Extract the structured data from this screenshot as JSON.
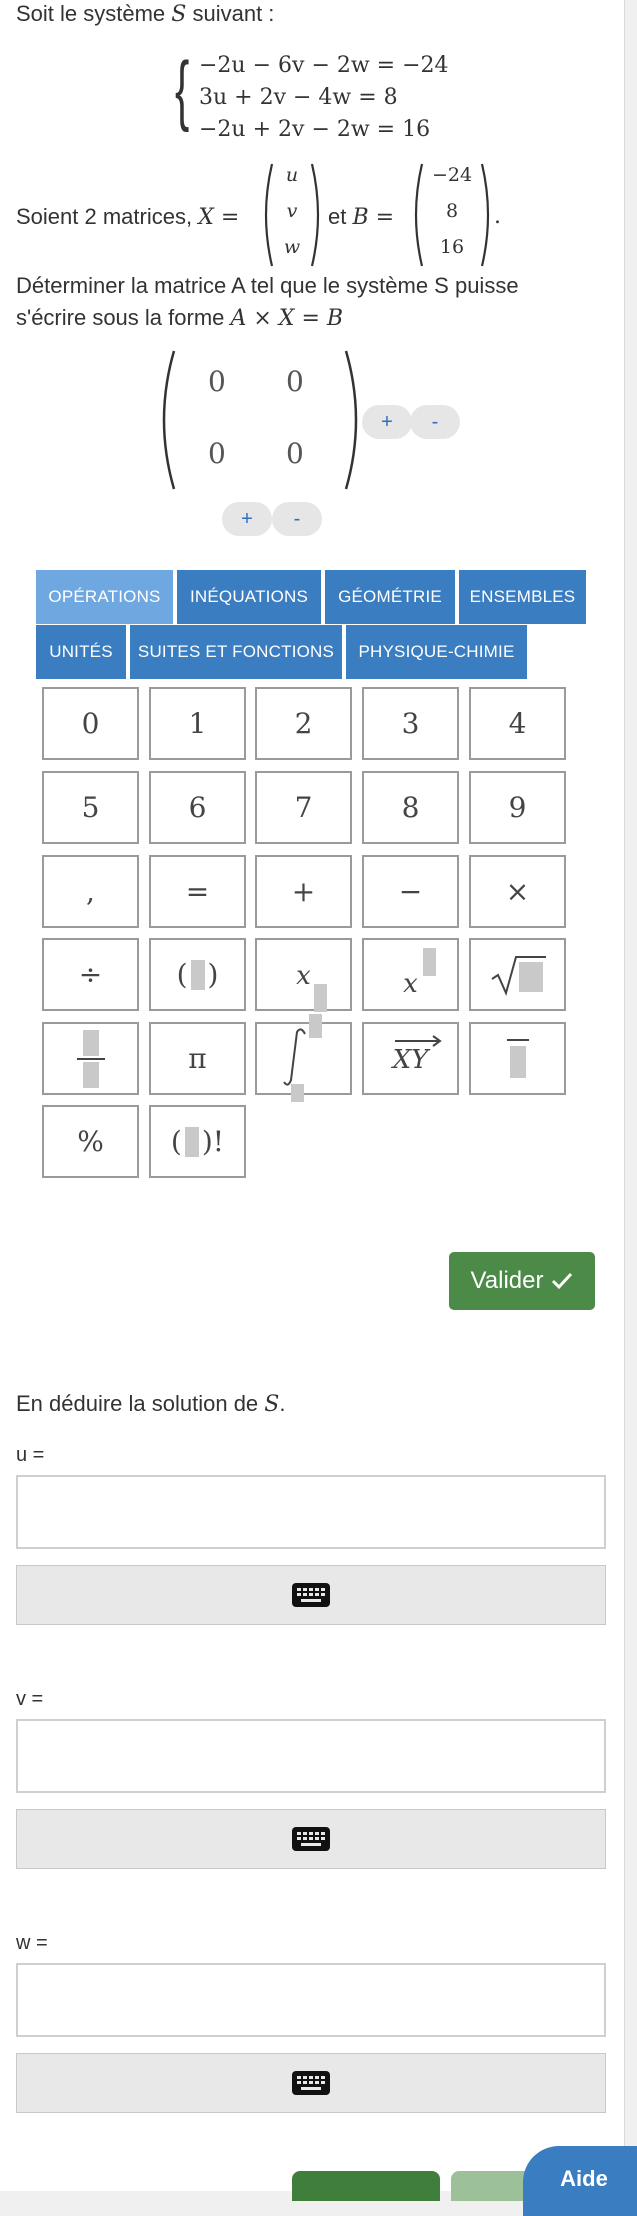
{
  "intro": {
    "prefix": "Soit le système ",
    "system_var": "S",
    "suffix": " suivant :"
  },
  "system": {
    "equations": [
      "−2u − 6v − 2w = −24",
      "3u + 2v − 4w = 8",
      "−2u + 2v − 2w = 16"
    ]
  },
  "matrices_sentence": {
    "prefix": "Soient 2 matrices, ",
    "x_name": "X",
    "x_values": [
      "u",
      "v",
      "w"
    ],
    "connector": "et",
    "b_name": "B",
    "b_values": [
      "−24",
      "8",
      "16"
    ]
  },
  "task": {
    "line1": "Déterminer la matrice A tel que le système S puisse",
    "line2_prefix": "s'écrire sous la forme ",
    "line2_math": "A × X = B"
  },
  "answer_matrix": {
    "cells": [
      "0",
      "0",
      "0",
      "0"
    ],
    "add_col": "+",
    "remove_col": "-",
    "add_row": "+",
    "remove_row": "-"
  },
  "tabs": {
    "row1": [
      "OPÉRATIONS",
      "INÉQUATIONS",
      "GÉOMÉTRIE",
      "ENSEMBLES"
    ],
    "row2": [
      "UNITÉS",
      "SUITES ET FONCTIONS",
      "PHYSIQUE-CHIMIE"
    ],
    "active": "OPÉRATIONS"
  },
  "keypad": {
    "digits": [
      "0",
      "1",
      "2",
      "3",
      "4",
      "5",
      "6",
      "7",
      "8",
      "9"
    ],
    "operators": [
      ",",
      "=",
      "+",
      "−",
      "×"
    ],
    "divide": "÷",
    "pi": "π",
    "percent": "%",
    "factorial": "!",
    "subscript_var": "x",
    "superscript_var": "x",
    "vector": "XY"
  },
  "validate": {
    "label": "Valider",
    "icon": "check-icon"
  },
  "deduce": {
    "prefix": "En déduire la solution de ",
    "var": "S",
    "suffix": "."
  },
  "answers": [
    {
      "label": "u =",
      "value": "",
      "keyboard_icon": "keyboard-icon"
    },
    {
      "label": "v =",
      "value": "",
      "keyboard_icon": "keyboard-icon"
    },
    {
      "label": "w =",
      "value": "",
      "keyboard_icon": "keyboard-icon"
    }
  ],
  "help": {
    "label": "Aide"
  },
  "colors": {
    "tab": "#3a7dc0",
    "tab_active": "#6fa7e0",
    "validate": "#4b8a47",
    "help": "#3a7dc0"
  }
}
